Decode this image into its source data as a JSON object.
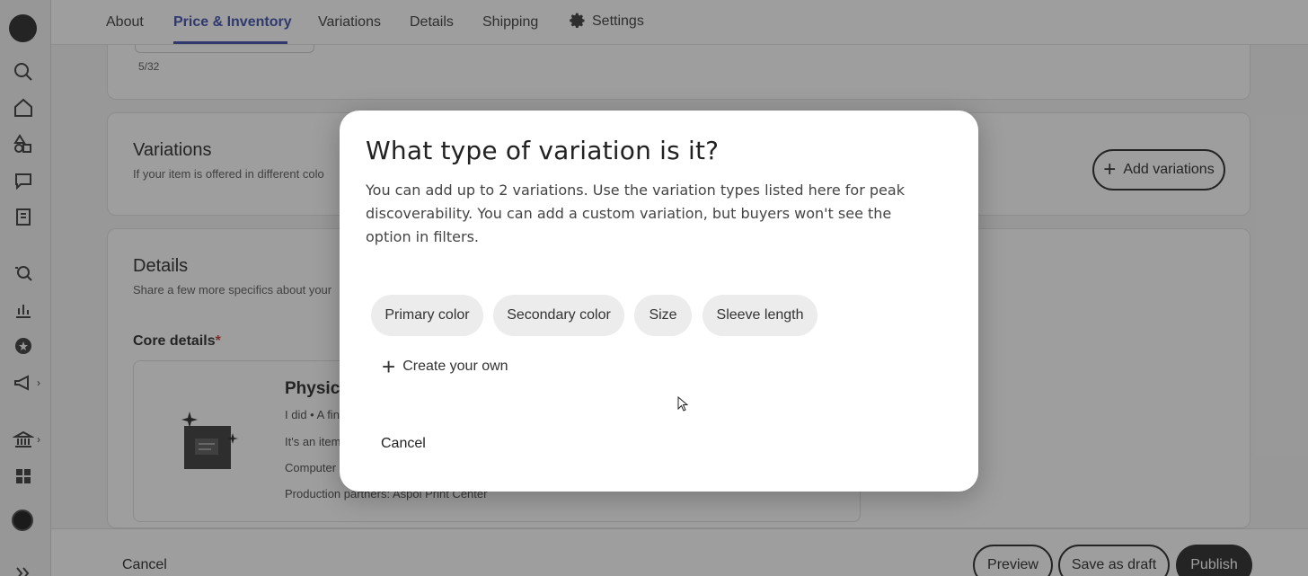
{
  "sidebar": {
    "icons": [
      "etsy-logo-icon",
      "search-icon",
      "home-icon",
      "shapes-icon",
      "messages-icon",
      "orders-icon",
      "search-insights-icon",
      "stats-icon",
      "star-badge-icon",
      "megaphone-icon",
      "bank-icon",
      "grid-icon",
      "avatar",
      "expand-icon"
    ]
  },
  "topnav": {
    "tabs": [
      {
        "label": "About"
      },
      {
        "label": "Price & Inventory"
      },
      {
        "label": "Variations"
      },
      {
        "label": "Details"
      },
      {
        "label": "Shipping"
      },
      {
        "label": "Settings"
      }
    ]
  },
  "page": {
    "char_count": "5/32",
    "variations": {
      "title": "Variations",
      "subtitle": "If your item is offered in different colo",
      "add_button": "Add variations"
    },
    "details": {
      "title": "Details",
      "subtitle": "Share a few more specifics about your",
      "core_details_label": "Core details",
      "required_mark": "*",
      "item_title": "Physica",
      "line1": "I did • A fin",
      "line2": "It's an item",
      "line3": "Computer",
      "line4": "Production partners: Aspol Print Center"
    },
    "footer": {
      "cancel": "Cancel",
      "preview": "Preview",
      "save_draft": "Save as draft",
      "publish": "Publish"
    }
  },
  "modal": {
    "title": "What type of variation is it?",
    "description": "You can add up to 2 variations. Use the variation types listed here for peak discoverability. You can add a custom variation, but buyers won't see the option in filters.",
    "options": [
      {
        "label": "Primary color"
      },
      {
        "label": "Secondary color"
      },
      {
        "label": "Size"
      },
      {
        "label": "Sleeve length"
      }
    ],
    "create_own": "Create your own",
    "cancel": "Cancel"
  }
}
